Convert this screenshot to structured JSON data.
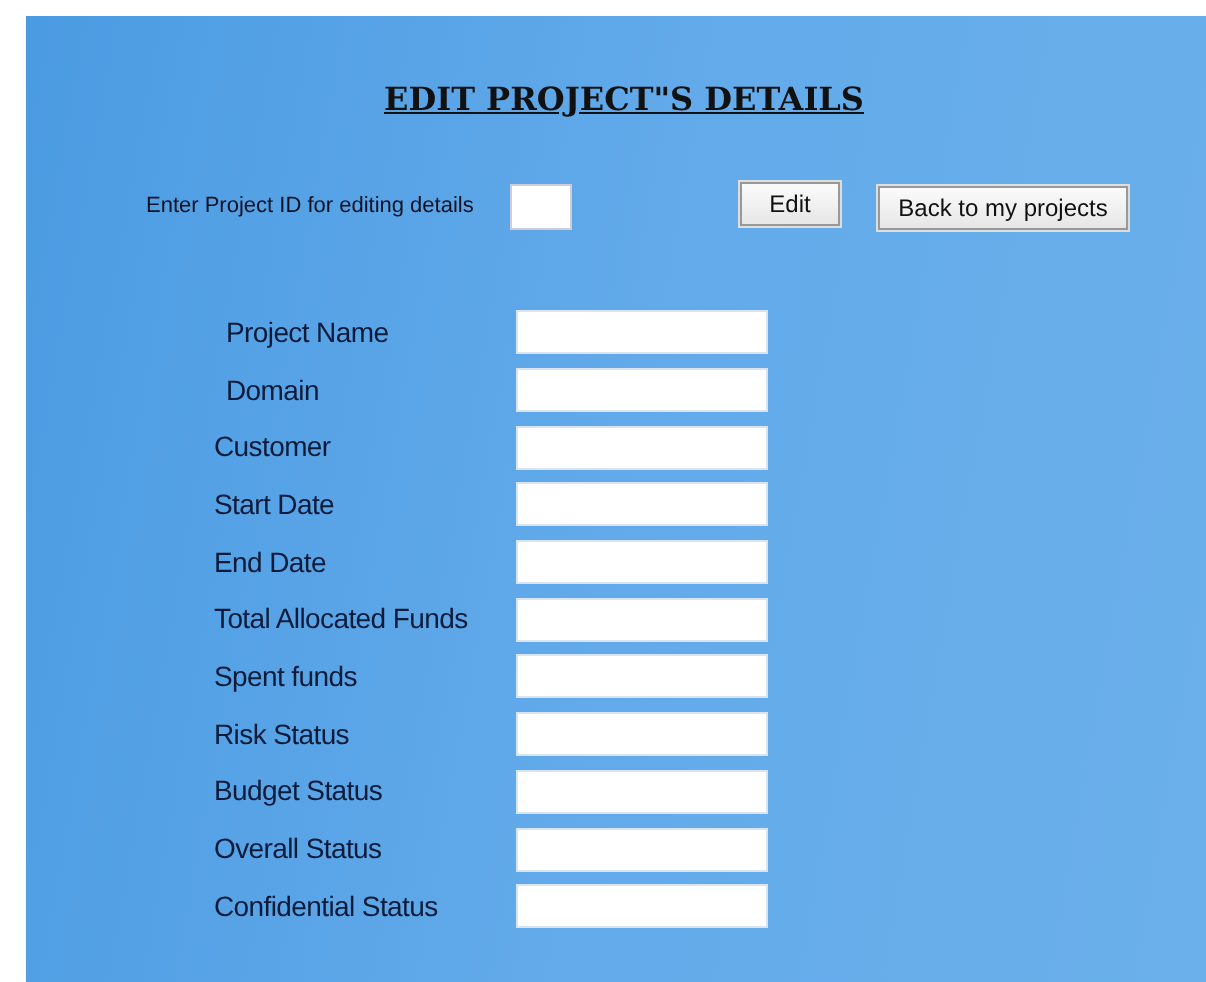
{
  "title": "EDIT PROJECT\"S DETAILS",
  "id_prompt": {
    "label": "Enter Project ID for editing details"
  },
  "buttons": [
    {
      "label": "Edit",
      "kind": "edit"
    },
    {
      "label": "Back to my projects",
      "kind": "back"
    }
  ],
  "fields": [
    {
      "label": "Project Name",
      "indented": true
    },
    {
      "label": "Domain",
      "indented": true
    },
    {
      "label": "Customer",
      "indented": false
    },
    {
      "label": "Start Date",
      "indented": false
    },
    {
      "label": "End Date",
      "indented": false
    },
    {
      "label": "Total Allocated Funds",
      "indented": false
    },
    {
      "label": "Spent funds",
      "indented": false
    },
    {
      "label": "Risk Status",
      "indented": false
    },
    {
      "label": "Budget Status",
      "indented": false
    },
    {
      "label": "Overall Status",
      "indented": false
    },
    {
      "label": "Confidential Status",
      "indented": false
    }
  ]
}
